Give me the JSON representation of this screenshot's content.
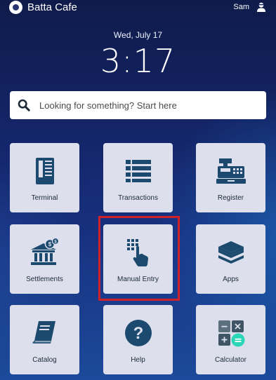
{
  "statusbar": {
    "app_name": "Batta Cafe",
    "user_name": "Sam"
  },
  "clock": {
    "date": "Wed, July 17",
    "time": "3:17"
  },
  "search": {
    "placeholder": "Looking for something? Start here"
  },
  "tiles": [
    {
      "label": "Terminal",
      "icon": "card-terminal-icon"
    },
    {
      "label": "Transactions",
      "icon": "list-icon"
    },
    {
      "label": "Register",
      "icon": "cash-register-icon"
    },
    {
      "label": "Settlements",
      "icon": "bank-icon"
    },
    {
      "label": "Manual Entry",
      "icon": "keypad-hand-icon"
    },
    {
      "label": "Apps",
      "icon": "layers-icon"
    },
    {
      "label": "Catalog",
      "icon": "book-icon"
    },
    {
      "label": "Help",
      "icon": "question-icon"
    },
    {
      "label": "Calculator",
      "icon": "calculator-icon"
    }
  ],
  "colors": {
    "icon_primary": "#1b4a6e",
    "tile_bg": "#dde0ec",
    "highlight": "#d0202a",
    "calc_accent": "#2bd6b7"
  }
}
